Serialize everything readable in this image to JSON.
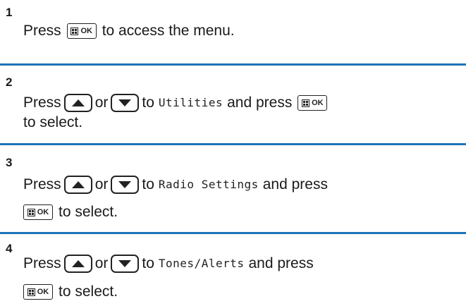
{
  "steps": [
    {
      "number": "1",
      "lines": [
        {
          "t1": "Press",
          "t2": "to access the menu."
        }
      ]
    },
    {
      "number": "2",
      "line1": {
        "press": "Press",
        "or": "or",
        "to": "to",
        "menu_item": "Utilities",
        "and_press": "and press"
      },
      "line2": {
        "text": "to select."
      }
    },
    {
      "number": "3",
      "line1": {
        "press": "Press",
        "or": "or",
        "to": "to",
        "menu_item": "Radio Settings",
        "and_press": "and press"
      },
      "line2": {
        "text": "to select."
      }
    },
    {
      "number": "4",
      "line1": {
        "press": "Press",
        "or": "or",
        "to": "to",
        "menu_item": "Tones/Alerts",
        "and_press": "and press"
      },
      "line2": {
        "text": "to select."
      }
    }
  ],
  "icons": {
    "menu_ok_key": "menu-ok-key-icon",
    "up_key": "up-arrow-key-icon",
    "down_key": "down-arrow-key-icon",
    "ok_label": "OK"
  },
  "colors": {
    "divider": "#1e73b8",
    "text": "#1a1a1a"
  }
}
